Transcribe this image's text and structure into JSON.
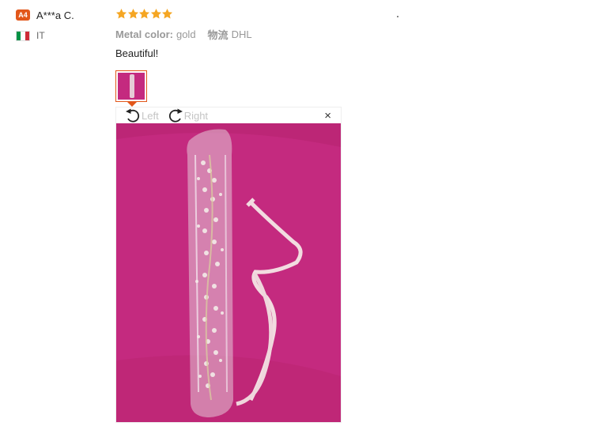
{
  "reviewer": {
    "badge": "A4",
    "name": "A***a C.",
    "country_code": "IT",
    "flag_colors": [
      "#009246",
      "#ffffff",
      "#ce2b37"
    ]
  },
  "review": {
    "rating": 5,
    "rating_max": 5,
    "star_color": "#f5a623",
    "attributes": [
      {
        "key": "Metal color:",
        "value": "gold"
      },
      {
        "key": "物流",
        "value": "DHL"
      }
    ],
    "text": "Beautiful!"
  },
  "viewer": {
    "rotate_left_label": "Left",
    "rotate_right_label": "Right",
    "close_icon": "×",
    "photo_background": "#c42a7f"
  },
  "colors": {
    "accent": "#e2571a"
  }
}
